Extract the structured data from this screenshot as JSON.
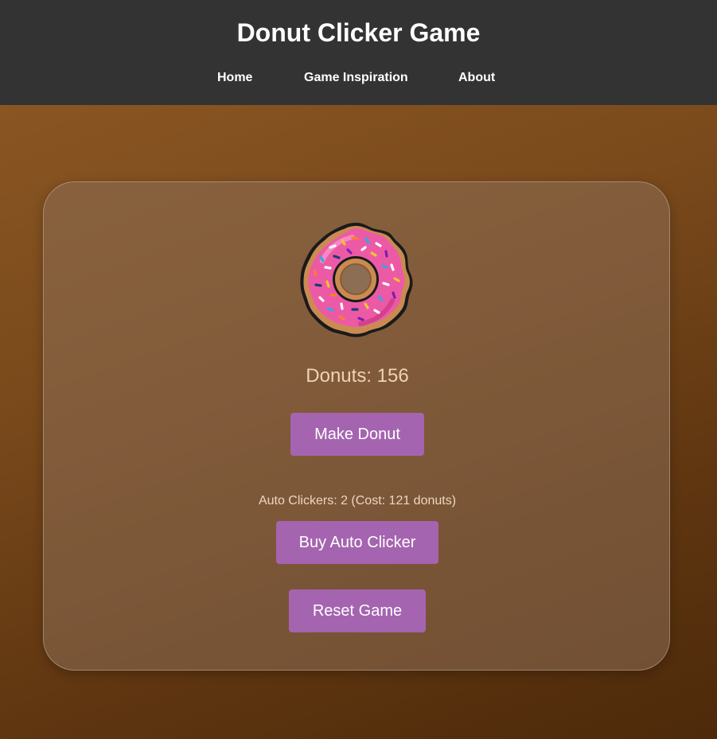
{
  "header": {
    "title": "Donut Clicker Game",
    "nav": [
      {
        "label": "Home"
      },
      {
        "label": "Game Inspiration"
      },
      {
        "label": "About"
      }
    ]
  },
  "game": {
    "donut_icon": "donut-icon",
    "count_text": "Donuts: 156",
    "donut_count": 156,
    "make_button_label": "Make Donut",
    "auto_clicker_text": "Auto Clickers: 2 (Cost: 121 donuts)",
    "auto_clickers": 2,
    "auto_clicker_cost": 121,
    "buy_button_label": "Buy Auto Clicker",
    "reset_button_label": "Reset Game"
  },
  "colors": {
    "header_bg": "#333333",
    "button_bg": "#a564b0",
    "frosting": "#ec5aa6",
    "dough": "#c98b52",
    "count_text": "#f0d2b5"
  }
}
